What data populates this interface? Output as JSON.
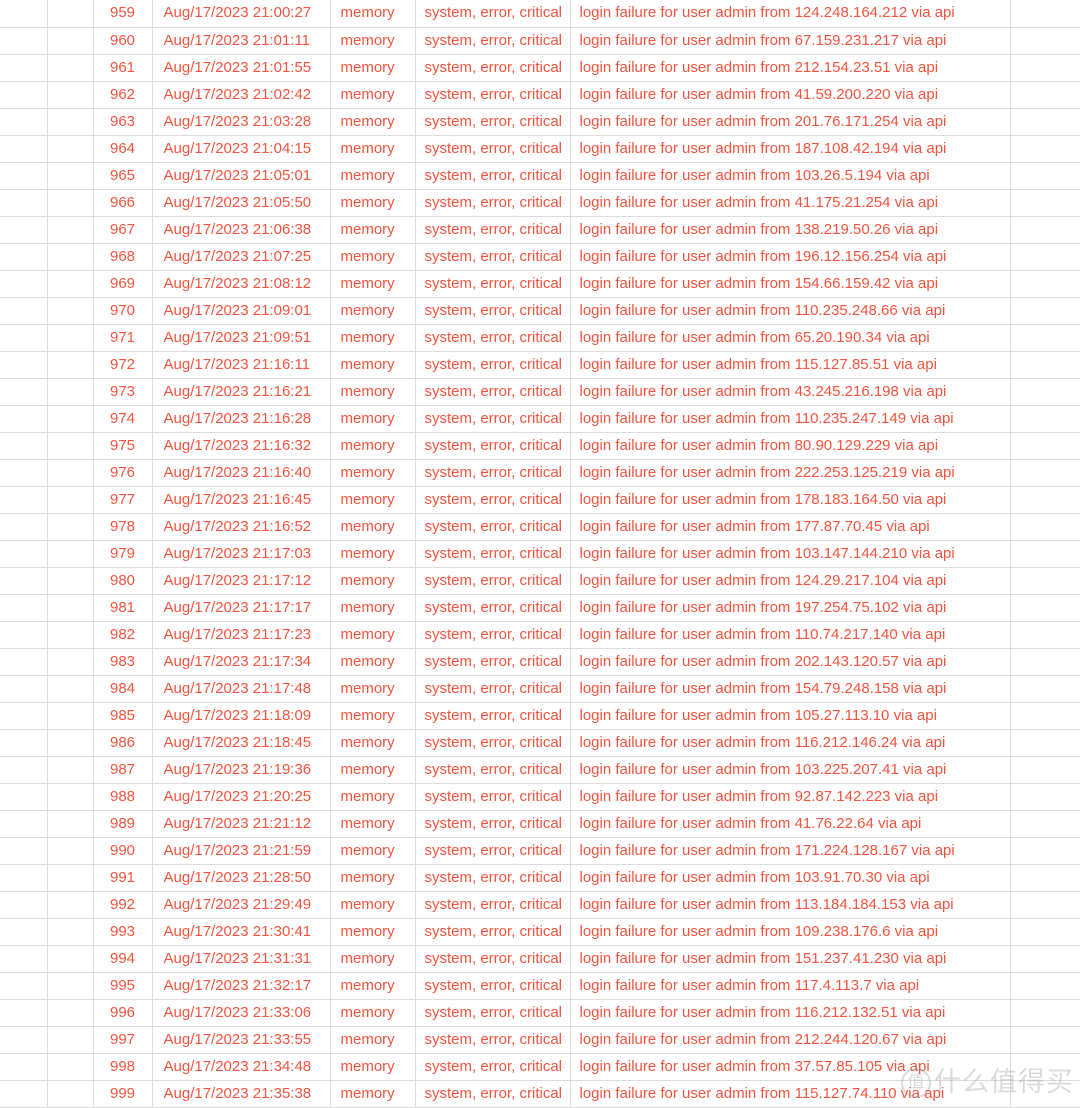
{
  "table": {
    "columns": [
      {
        "key": "blank_left_1",
        "label": "",
        "type": "spacer"
      },
      {
        "key": "blank_left_2",
        "label": "",
        "type": "spacer"
      },
      {
        "key": "id",
        "label": "",
        "type": "id"
      },
      {
        "key": "timestamp",
        "label": "",
        "type": "datetime"
      },
      {
        "key": "buffer",
        "label": "",
        "type": "text"
      },
      {
        "key": "topics",
        "label": "",
        "type": "text"
      },
      {
        "key": "message",
        "label": "",
        "type": "text"
      },
      {
        "key": "blank_right",
        "label": "",
        "type": "spacer"
      }
    ],
    "text_color": "#f4543e",
    "grid_color": "#dcdcdc",
    "row_background": "#ffffff",
    "rows": [
      {
        "id": "959",
        "timestamp": "Aug/17/2023 21:00:27",
        "buffer": "memory",
        "topics": "system, error, critical",
        "message": "login failure for user admin from 124.248.164.212 via api"
      },
      {
        "id": "960",
        "timestamp": "Aug/17/2023 21:01:11",
        "buffer": "memory",
        "topics": "system, error, critical",
        "message": "login failure for user admin from 67.159.231.217 via api"
      },
      {
        "id": "961",
        "timestamp": "Aug/17/2023 21:01:55",
        "buffer": "memory",
        "topics": "system, error, critical",
        "message": "login failure for user admin from 212.154.23.51 via api"
      },
      {
        "id": "962",
        "timestamp": "Aug/17/2023 21:02:42",
        "buffer": "memory",
        "topics": "system, error, critical",
        "message": "login failure for user admin from 41.59.200.220 via api"
      },
      {
        "id": "963",
        "timestamp": "Aug/17/2023 21:03:28",
        "buffer": "memory",
        "topics": "system, error, critical",
        "message": "login failure for user admin from 201.76.171.254 via api"
      },
      {
        "id": "964",
        "timestamp": "Aug/17/2023 21:04:15",
        "buffer": "memory",
        "topics": "system, error, critical",
        "message": "login failure for user admin from 187.108.42.194 via api"
      },
      {
        "id": "965",
        "timestamp": "Aug/17/2023 21:05:01",
        "buffer": "memory",
        "topics": "system, error, critical",
        "message": "login failure for user admin from 103.26.5.194 via api"
      },
      {
        "id": "966",
        "timestamp": "Aug/17/2023 21:05:50",
        "buffer": "memory",
        "topics": "system, error, critical",
        "message": "login failure for user admin from 41.175.21.254 via api"
      },
      {
        "id": "967",
        "timestamp": "Aug/17/2023 21:06:38",
        "buffer": "memory",
        "topics": "system, error, critical",
        "message": "login failure for user admin from 138.219.50.26 via api"
      },
      {
        "id": "968",
        "timestamp": "Aug/17/2023 21:07:25",
        "buffer": "memory",
        "topics": "system, error, critical",
        "message": "login failure for user admin from 196.12.156.254 via api"
      },
      {
        "id": "969",
        "timestamp": "Aug/17/2023 21:08:12",
        "buffer": "memory",
        "topics": "system, error, critical",
        "message": "login failure for user admin from 154.66.159.42 via api"
      },
      {
        "id": "970",
        "timestamp": "Aug/17/2023 21:09:01",
        "buffer": "memory",
        "topics": "system, error, critical",
        "message": "login failure for user admin from 110.235.248.66 via api"
      },
      {
        "id": "971",
        "timestamp": "Aug/17/2023 21:09:51",
        "buffer": "memory",
        "topics": "system, error, critical",
        "message": "login failure for user admin from 65.20.190.34 via api"
      },
      {
        "id": "972",
        "timestamp": "Aug/17/2023 21:16:11",
        "buffer": "memory",
        "topics": "system, error, critical",
        "message": "login failure for user admin from 115.127.85.51 via api"
      },
      {
        "id": "973",
        "timestamp": "Aug/17/2023 21:16:21",
        "buffer": "memory",
        "topics": "system, error, critical",
        "message": "login failure for user admin from 43.245.216.198 via api"
      },
      {
        "id": "974",
        "timestamp": "Aug/17/2023 21:16:28",
        "buffer": "memory",
        "topics": "system, error, critical",
        "message": "login failure for user admin from 110.235.247.149 via api"
      },
      {
        "id": "975",
        "timestamp": "Aug/17/2023 21:16:32",
        "buffer": "memory",
        "topics": "system, error, critical",
        "message": "login failure for user admin from 80.90.129.229 via api"
      },
      {
        "id": "976",
        "timestamp": "Aug/17/2023 21:16:40",
        "buffer": "memory",
        "topics": "system, error, critical",
        "message": "login failure for user admin from 222.253.125.219 via api"
      },
      {
        "id": "977",
        "timestamp": "Aug/17/2023 21:16:45",
        "buffer": "memory",
        "topics": "system, error, critical",
        "message": "login failure for user admin from 178.183.164.50 via api"
      },
      {
        "id": "978",
        "timestamp": "Aug/17/2023 21:16:52",
        "buffer": "memory",
        "topics": "system, error, critical",
        "message": "login failure for user admin from 177.87.70.45 via api"
      },
      {
        "id": "979",
        "timestamp": "Aug/17/2023 21:17:03",
        "buffer": "memory",
        "topics": "system, error, critical",
        "message": "login failure for user admin from 103.147.144.210 via api"
      },
      {
        "id": "980",
        "timestamp": "Aug/17/2023 21:17:12",
        "buffer": "memory",
        "topics": "system, error, critical",
        "message": "login failure for user admin from 124.29.217.104 via api"
      },
      {
        "id": "981",
        "timestamp": "Aug/17/2023 21:17:17",
        "buffer": "memory",
        "topics": "system, error, critical",
        "message": "login failure for user admin from 197.254.75.102 via api"
      },
      {
        "id": "982",
        "timestamp": "Aug/17/2023 21:17:23",
        "buffer": "memory",
        "topics": "system, error, critical",
        "message": "login failure for user admin from 110.74.217.140 via api"
      },
      {
        "id": "983",
        "timestamp": "Aug/17/2023 21:17:34",
        "buffer": "memory",
        "topics": "system, error, critical",
        "message": "login failure for user admin from 202.143.120.57 via api"
      },
      {
        "id": "984",
        "timestamp": "Aug/17/2023 21:17:48",
        "buffer": "memory",
        "topics": "system, error, critical",
        "message": "login failure for user admin from 154.79.248.158 via api"
      },
      {
        "id": "985",
        "timestamp": "Aug/17/2023 21:18:09",
        "buffer": "memory",
        "topics": "system, error, critical",
        "message": "login failure for user admin from 105.27.113.10 via api"
      },
      {
        "id": "986",
        "timestamp": "Aug/17/2023 21:18:45",
        "buffer": "memory",
        "topics": "system, error, critical",
        "message": "login failure for user admin from 116.212.146.24 via api"
      },
      {
        "id": "987",
        "timestamp": "Aug/17/2023 21:19:36",
        "buffer": "memory",
        "topics": "system, error, critical",
        "message": "login failure for user admin from 103.225.207.41 via api"
      },
      {
        "id": "988",
        "timestamp": "Aug/17/2023 21:20:25",
        "buffer": "memory",
        "topics": "system, error, critical",
        "message": "login failure for user admin from 92.87.142.223 via api"
      },
      {
        "id": "989",
        "timestamp": "Aug/17/2023 21:21:12",
        "buffer": "memory",
        "topics": "system, error, critical",
        "message": "login failure for user admin from 41.76.22.64 via api"
      },
      {
        "id": "990",
        "timestamp": "Aug/17/2023 21:21:59",
        "buffer": "memory",
        "topics": "system, error, critical",
        "message": "login failure for user admin from 171.224.128.167 via api"
      },
      {
        "id": "991",
        "timestamp": "Aug/17/2023 21:28:50",
        "buffer": "memory",
        "topics": "system, error, critical",
        "message": "login failure for user admin from 103.91.70.30 via api"
      },
      {
        "id": "992",
        "timestamp": "Aug/17/2023 21:29:49",
        "buffer": "memory",
        "topics": "system, error, critical",
        "message": "login failure for user admin from 113.184.184.153 via api"
      },
      {
        "id": "993",
        "timestamp": "Aug/17/2023 21:30:41",
        "buffer": "memory",
        "topics": "system, error, critical",
        "message": "login failure for user admin from 109.238.176.6 via api"
      },
      {
        "id": "994",
        "timestamp": "Aug/17/2023 21:31:31",
        "buffer": "memory",
        "topics": "system, error, critical",
        "message": "login failure for user admin from 151.237.41.230 via api"
      },
      {
        "id": "995",
        "timestamp": "Aug/17/2023 21:32:17",
        "buffer": "memory",
        "topics": "system, error, critical",
        "message": "login failure for user admin from 117.4.113.7 via api"
      },
      {
        "id": "996",
        "timestamp": "Aug/17/2023 21:33:06",
        "buffer": "memory",
        "topics": "system, error, critical",
        "message": "login failure for user admin from 116.212.132.51 via api"
      },
      {
        "id": "997",
        "timestamp": "Aug/17/2023 21:33:55",
        "buffer": "memory",
        "topics": "system, error, critical",
        "message": "login failure for user admin from 212.244.120.67 via api"
      },
      {
        "id": "998",
        "timestamp": "Aug/17/2023 21:34:48",
        "buffer": "memory",
        "topics": "system, error, critical",
        "message": "login failure for user admin from 37.57.85.105 via api"
      },
      {
        "id": "999",
        "timestamp": "Aug/17/2023 21:35:38",
        "buffer": "memory",
        "topics": "system, error, critical",
        "message": "login failure for user admin from 115.127.74.110 via api"
      }
    ]
  },
  "watermark": {
    "badge": "值",
    "text": "什么值得买"
  }
}
